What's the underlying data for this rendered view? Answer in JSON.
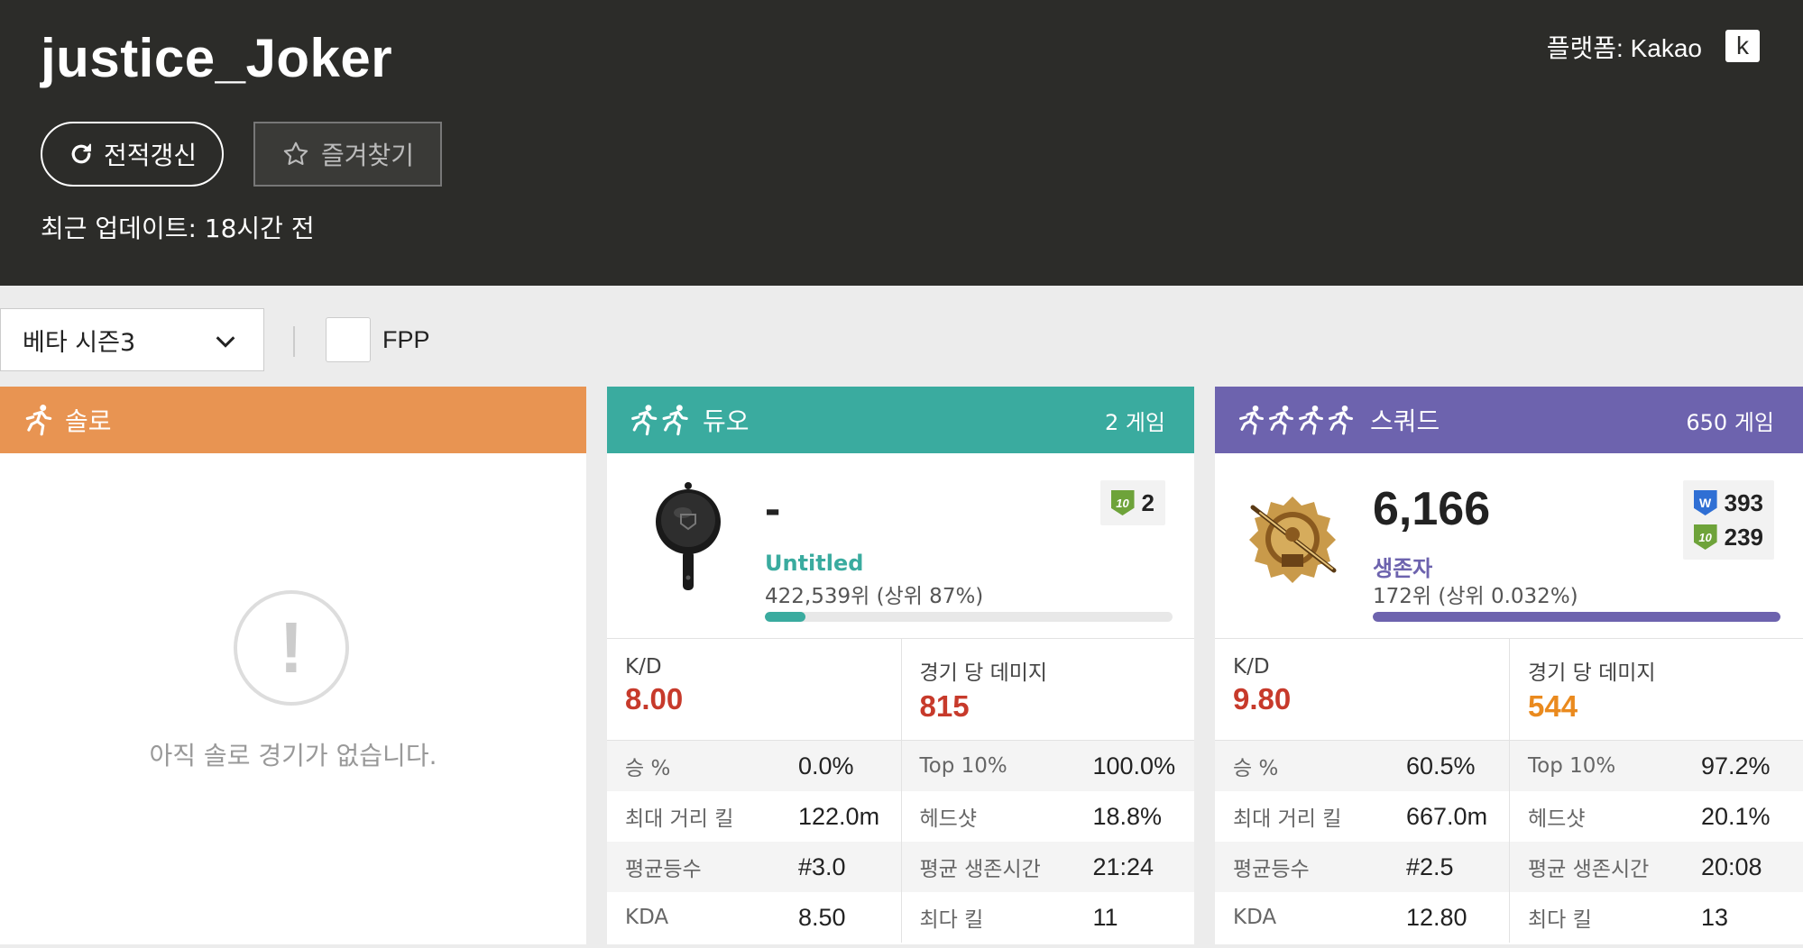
{
  "header": {
    "player_name": "justice_Joker",
    "refresh_label": "전적갱신",
    "favorite_label": "즐겨찾기",
    "last_update": "최근 업데이트: 18시간 전",
    "platform": "플랫폼: Kakao",
    "platform_logo_letter": "k"
  },
  "filters": {
    "season": "베타 시즌3",
    "fpp_label": "FPP"
  },
  "colors": {
    "solo": "#e89452",
    "duo": "#3aab9f",
    "squad": "#6d63ae"
  },
  "solo": {
    "title": "솔로",
    "empty_icon": "!",
    "empty_text": "아직 솔로 경기가 없습니다."
  },
  "duo": {
    "title": "듀오",
    "games": "2 게임",
    "rank_points": "-",
    "tier": "Untitled",
    "rank_position": "422,539위 (상위 87%)",
    "rank_progress": 0.1,
    "top10_badge_label": "10",
    "top10_count": "2",
    "kd_label": "K/D",
    "kd": "8.00",
    "damage_label": "경기 당 데미지",
    "damage": "815",
    "rows": [
      {
        "k1": "승 %",
        "v1": "0.0%",
        "k2": "Top 10%",
        "v2": "100.0%"
      },
      {
        "k1": "최대 거리 킬",
        "v1": "122.0m",
        "k2": "헤드샷",
        "v2": "18.8%"
      },
      {
        "k1": "평균등수",
        "v1": "#3.0",
        "k2": "평균 생존시간",
        "v2": "21:24"
      },
      {
        "k1": "KDA",
        "v1": "8.50",
        "k2": "최다 킬",
        "v2": "11"
      }
    ]
  },
  "squad": {
    "title": "스쿼드",
    "games": "650 게임",
    "rank_points": "6,166",
    "tier": "생존자",
    "rank_position": "172위 (상위 0.032%)",
    "rank_progress": 1.0,
    "win_badge_label": "W",
    "win_count": "393",
    "top10_badge_label": "10",
    "top10_count": "239",
    "kd_label": "K/D",
    "kd": "9.80",
    "damage_label": "경기 당 데미지",
    "damage": "544",
    "rows": [
      {
        "k1": "승 %",
        "v1": "60.5%",
        "k2": "Top 10%",
        "v2": "97.2%"
      },
      {
        "k1": "최대 거리 킬",
        "v1": "667.0m",
        "k2": "헤드샷",
        "v2": "20.1%"
      },
      {
        "k1": "평균등수",
        "v1": "#2.5",
        "k2": "평균 생존시간",
        "v2": "20:08"
      },
      {
        "k1": "KDA",
        "v1": "12.80",
        "k2": "최다 킬",
        "v2": "13"
      }
    ]
  }
}
